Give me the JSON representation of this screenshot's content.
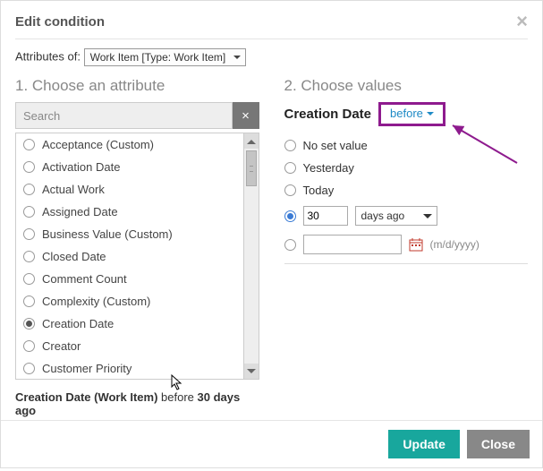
{
  "dialog": {
    "title": "Edit condition",
    "attributes_of_label": "Attributes of:",
    "attributes_of_value": "Work Item [Type: Work Item]"
  },
  "left": {
    "title": "1. Choose an attribute",
    "search_placeholder": "Search",
    "clear_glyph": "×",
    "items": [
      {
        "label": "Acceptance (Custom)",
        "selected": false
      },
      {
        "label": "Activation Date",
        "selected": false
      },
      {
        "label": "Actual Work",
        "selected": false
      },
      {
        "label": "Assigned Date",
        "selected": false
      },
      {
        "label": "Business Value (Custom)",
        "selected": false
      },
      {
        "label": "Closed Date",
        "selected": false
      },
      {
        "label": "Comment Count",
        "selected": false
      },
      {
        "label": "Complexity (Custom)",
        "selected": false
      },
      {
        "label": "Creation Date",
        "selected": true
      },
      {
        "label": "Creator",
        "selected": false
      },
      {
        "label": "Customer Priority",
        "selected": false
      }
    ]
  },
  "summary": {
    "attr": "Creation Date (Work Item)",
    "mid": " before ",
    "value": "30 days ago"
  },
  "right": {
    "title": "2. Choose values",
    "attr_name": "Creation Date",
    "operator": "before",
    "options": {
      "no_set": "No set value",
      "yesterday": "Yesterday",
      "today": "Today",
      "num_value": "30",
      "unit_label": "days ago",
      "date_value": "",
      "date_hint": "(m/d/yyyy)"
    },
    "selected": "num"
  },
  "footer": {
    "update": "Update",
    "close": "Close"
  }
}
